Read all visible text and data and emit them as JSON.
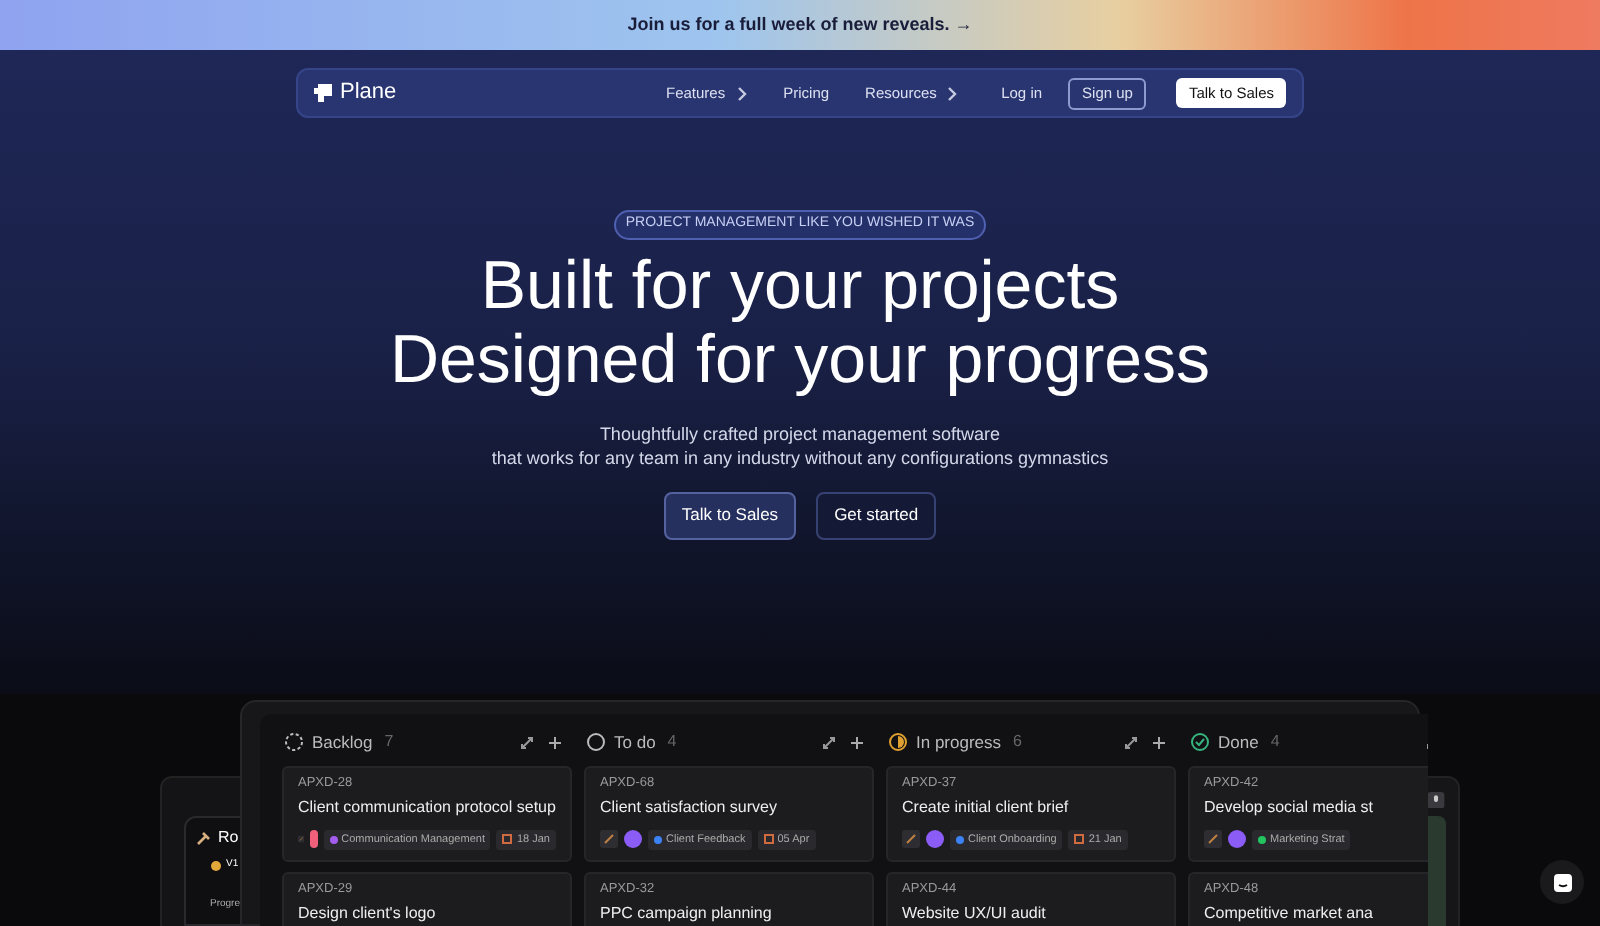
{
  "banner": {
    "text": "Join us for a full week of new reveals. →"
  },
  "nav": {
    "logo": "Plane",
    "links": [
      {
        "label": "Features",
        "dropdown": true
      },
      {
        "label": "Pricing",
        "dropdown": false
      },
      {
        "label": "Resources",
        "dropdown": true
      }
    ],
    "login": "Log in",
    "signup": "Sign up",
    "cta": "Talk to Sales"
  },
  "hero": {
    "badge": "PROJECT MANAGEMENT LIKE YOU WISHED IT WAS",
    "headline": [
      "Built for your projects",
      "Designed for your progress"
    ],
    "subtitle": [
      "Thoughtfully crafted project management software",
      "that works for any team in any industry without any configurations gymnastics"
    ],
    "buttons": [
      "Talk to Sales",
      "Get started"
    ]
  },
  "back_window": {
    "title": "Ro",
    "item": "V1",
    "label": "Progre"
  },
  "board": {
    "columns": [
      {
        "kind": "backlog",
        "name": "Backlog",
        "count": "7",
        "cards": [
          {
            "id": "APXD-28",
            "title": "Client communication protocol setup",
            "avatar": {
              "color": "#f0607a"
            },
            "tag": {
              "text": "Communication Management",
              "color": "#a35cf0"
            },
            "date": "18 Jan"
          },
          {
            "id": "APXD-29",
            "title": "Design client's logo"
          }
        ]
      },
      {
        "kind": "todo",
        "name": "To do",
        "count": "4",
        "cards": [
          {
            "id": "APXD-68",
            "title": "Client satisfaction survey",
            "avatar": {
              "color": "#8b5cf6"
            },
            "tag": {
              "text": "Client Feedback",
              "color": "#3b82f6"
            },
            "date": "05 Apr"
          },
          {
            "id": "APXD-32",
            "title": "PPC campaign planning"
          }
        ]
      },
      {
        "kind": "in_progress",
        "name": "In progress",
        "count": "6",
        "cards": [
          {
            "id": "APXD-37",
            "title": "Create initial client brief",
            "avatar": {
              "color": "#8b5cf6"
            },
            "tag": {
              "text": "Client Onboarding",
              "color": "#3b82f6"
            },
            "date": "21 Jan"
          },
          {
            "id": "APXD-44",
            "title": "Website UX/UI audit"
          }
        ]
      },
      {
        "kind": "done",
        "name": "Done",
        "count": "4",
        "cards": [
          {
            "id": "APXD-42",
            "title": "Develop social media st",
            "avatar": {
              "color": "#8b5cf6"
            },
            "tag": {
              "text": "Marketing Strat",
              "color": "#22c55e"
            }
          },
          {
            "id": "APXD-48",
            "title": "Competitive market ana"
          }
        ]
      }
    ]
  }
}
